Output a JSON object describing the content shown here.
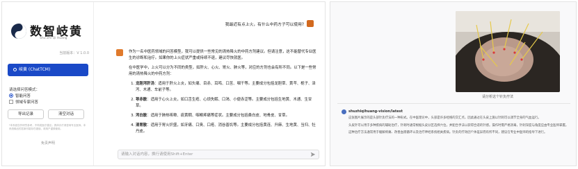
{
  "left_app": {
    "logo": {
      "title": "数智岐黄",
      "subtitle": "Shu Zhi Qi Huang"
    },
    "version": "当前版本：V 1.0.0",
    "model_button": "岐黄 (ChatTCM)",
    "mode": {
      "title": "请选择问答模式：",
      "options": [
        {
          "label": "智能问答",
          "selected": true
        },
        {
          "label": "领域专家问答",
          "selected": false
        }
      ]
    },
    "buttons": {
      "export": "导出记录",
      "clear": "清空对话"
    },
    "fineprint": "*本系统仅作研究参考，不构成医疗建议；具体诊疗请咨询专业医师。本系统输出的答案可能存在错误，请用户谨慎使用。",
    "disclaimer": "免责声明",
    "user_question": "我最近有点上火，有什么中药方子可以使用?",
    "answer": {
      "intro": "作为一名中医药领域的问答模型，我可以提供一些常见的清热降火的中药方剂建议。但请注意，这不能替代专业医生的诊断和治疗。如果你的上火症状严重或持续不退，建议尽快就医。",
      "para2": "在中医学中，上火可以分为不同的类型，如肝火、心火、胃火、肺火等，对应的方剂也会有所不同。以下是一些常用的清热降火的中药方剂：",
      "items": [
        {
          "name": "龙胆泻肝汤",
          "text": "适用于肝火上炎，如头痛、目赤、耳鸣、口苦、咽干等。主要成分包括龙胆草、黄芩、栀子、泽泻、木通、车前子等。"
        },
        {
          "name": "导赤散",
          "text": "适用于心火上炎，如口舌生疮、心烦失眠、口渴、小便赤涩等。主要成分包括生地黄、木通、生甘草。"
        },
        {
          "name": "泻白散",
          "text": "适用于肺热咳嗽、痰黄稠、咽喉疼痛等症状。主要成分包括桑白皮、地骨皮、甘草。"
        },
        {
          "name": "清胃散",
          "text": "适用于胃火炽盛，如牙痛、口臭、口疮、消谷善饥等。主要成分包括黄连、升麻、生地黄、当归、牡丹皮。"
        }
      ]
    },
    "input_placeholder": "请输入对话内容，换行请使用Shift+Enter"
  },
  "right_app": {
    "caption": "请分析这个针灸疗法",
    "bot_name": "shuzhiqihuang-vision/latest",
    "paragraphs": [
      "这张图片展示的是头部针灸疗法的一种形式。在中医理论中，头部是许多经络的交汇点，因此通过在头皮上施以针刺可以调节全身的气血运行。",
      "头皮针可以用于多种疾病的辅助治疗，针刺时通常根据头皮分区选择穴位，并配合手法以获得合适的针感。操作时需严格消毒，针刺深度与角度应由专业医师掌握。",
      "这种治疗方法通常用于缓解疼痛、改善血液循环以及治疗神经系统相关疾病。针灸的疗效因个体差异而有所不同，建议在专业中医师的指导下进行。"
    ]
  },
  "colors": {
    "primary": "#1a49c7",
    "accent": "#e07a2c"
  }
}
